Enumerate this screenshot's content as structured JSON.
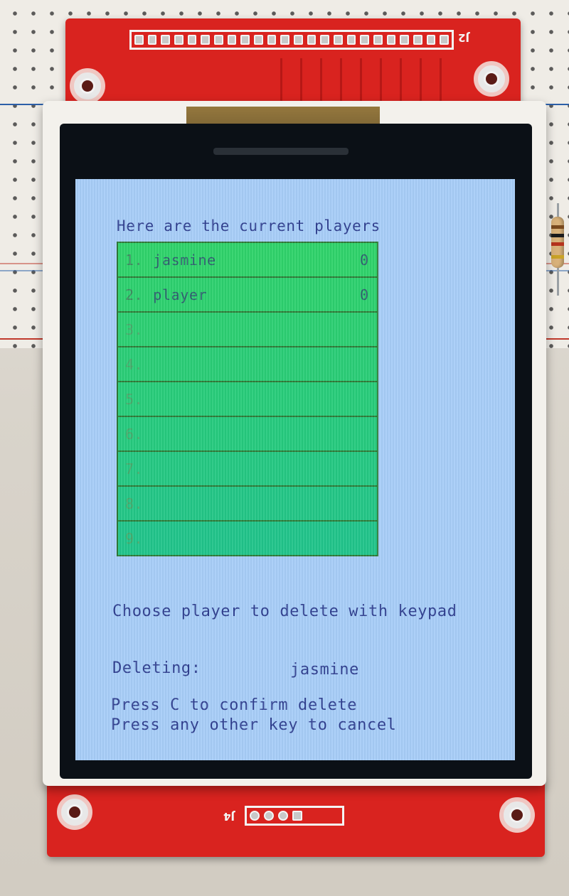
{
  "pcb": {
    "top_label": "J2",
    "bottom_label": "J4"
  },
  "screen": {
    "heading": "Here are the current players",
    "players": [
      {
        "num": "1.",
        "name": "jasmine",
        "score": "0"
      },
      {
        "num": "2.",
        "name": "player",
        "score": "0"
      },
      {
        "num": "3.",
        "name": "",
        "score": ""
      },
      {
        "num": "4.",
        "name": "",
        "score": ""
      },
      {
        "num": "5.",
        "name": "",
        "score": ""
      },
      {
        "num": "6.",
        "name": "",
        "score": ""
      },
      {
        "num": "7.",
        "name": "",
        "score": ""
      },
      {
        "num": "8.",
        "name": "",
        "score": ""
      },
      {
        "num": "9.",
        "name": "",
        "score": ""
      }
    ],
    "instruction": "Choose player to delete with keypad",
    "deleting_label": "Deleting:",
    "deleting_value": "jasmine",
    "confirm_line": "Press C to confirm delete",
    "cancel_line": "Press any other key to cancel"
  },
  "colors": {
    "screen_bg": "#a7cdf8",
    "text": "#2f3f8f",
    "row_top": "#2ed36a",
    "row_bottom": "#20c48a",
    "row_border": "#2e7a37",
    "pcb_red": "#d9231f"
  }
}
